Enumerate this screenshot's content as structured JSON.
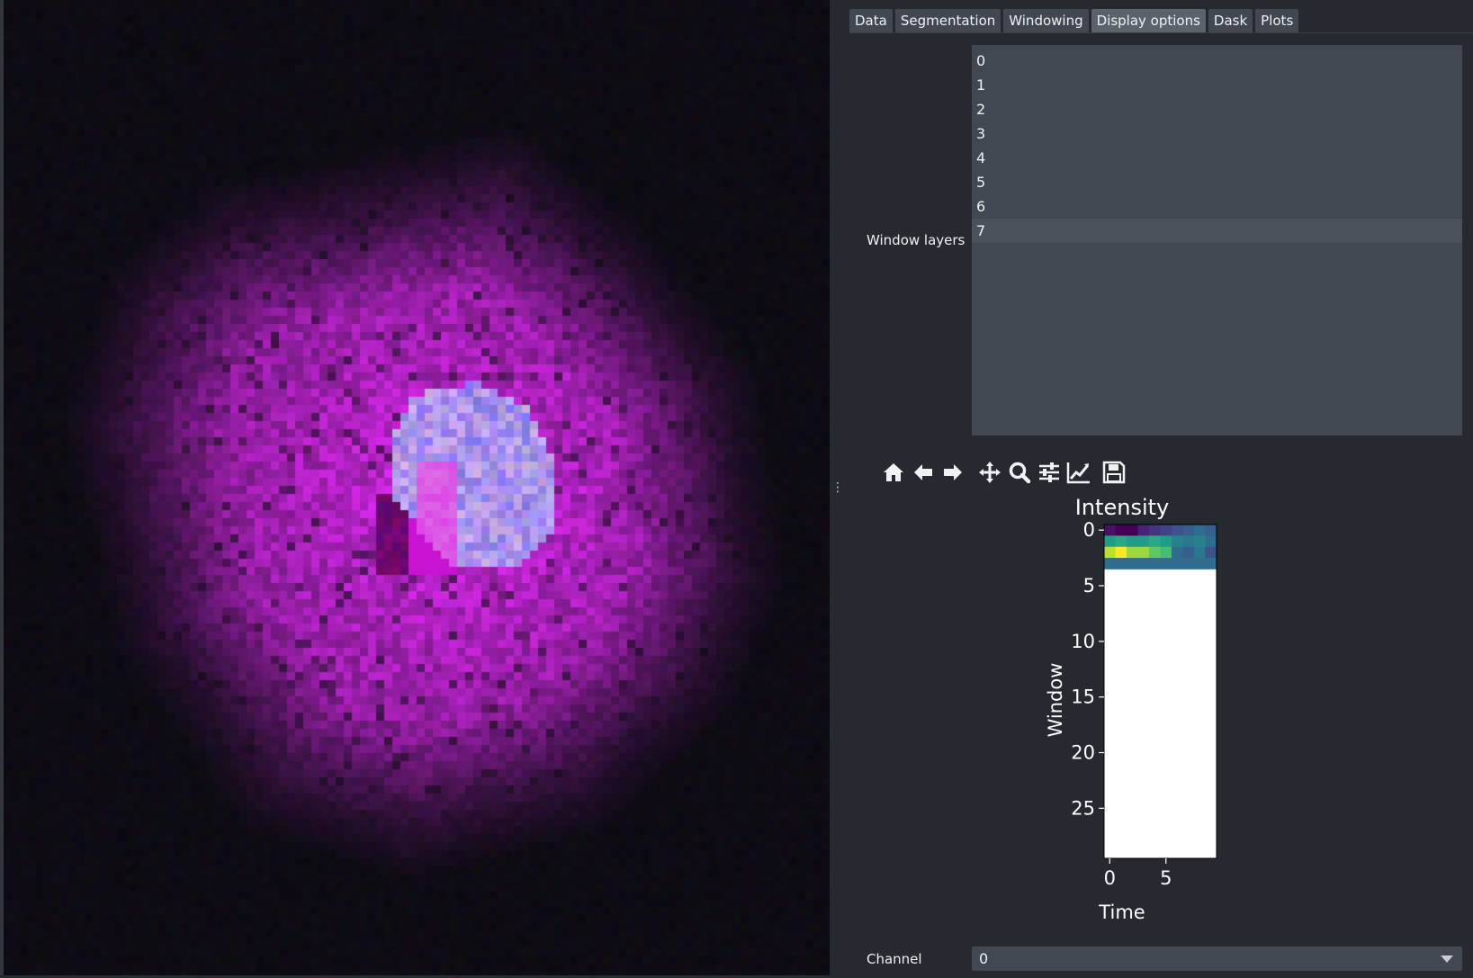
{
  "tabs": [
    {
      "label": "Data",
      "active": false
    },
    {
      "label": "Segmentation",
      "active": false
    },
    {
      "label": "Windowing",
      "active": false
    },
    {
      "label": "Display options",
      "active": true
    },
    {
      "label": "Dask",
      "active": false
    },
    {
      "label": "Plots",
      "active": false
    }
  ],
  "window_layers": {
    "label": "Window layers",
    "items": [
      "0",
      "1",
      "2",
      "3",
      "4",
      "5",
      "6",
      "7"
    ],
    "selected": "7"
  },
  "toolbar": [
    "home-icon",
    "back-arrow-icon",
    "forward-arrow-icon",
    "pan-icon",
    "zoom-icon",
    "configure-subplots-icon",
    "edit-axis-icon",
    "save-icon"
  ],
  "viewer": {
    "cell_color": "#d21ee0",
    "nucleus_color": "#b8b4ff"
  },
  "plot": {
    "title": "Intensity",
    "xlabel": "Time",
    "ylabel": "Window"
  },
  "chart_data": {
    "type": "heatmap",
    "title": "Intensity",
    "xlabel": "Time",
    "ylabel": "Window",
    "x_ticks": [
      0,
      5
    ],
    "y_ticks": [
      0,
      5,
      10,
      15,
      20,
      25
    ],
    "xlim": [
      -0.5,
      9.5
    ],
    "ylim": [
      29.5,
      -0.5
    ],
    "colormap": "viridis",
    "rows": [
      [
        0.05,
        0.0,
        0.0,
        0.1,
        0.15,
        0.2,
        0.25,
        0.3,
        0.35,
        0.3
      ],
      [
        0.55,
        0.6,
        0.55,
        0.55,
        0.6,
        0.55,
        0.45,
        0.4,
        0.45,
        0.35
      ],
      [
        0.9,
        1.0,
        0.85,
        0.85,
        0.75,
        0.7,
        0.35,
        0.3,
        0.4,
        0.25
      ],
      [
        0.35,
        0.35,
        0.35,
        0.35,
        0.35,
        0.35,
        0.35,
        0.35,
        0.35,
        0.35
      ]
    ]
  },
  "channel": {
    "label": "Channel",
    "value": "0"
  }
}
